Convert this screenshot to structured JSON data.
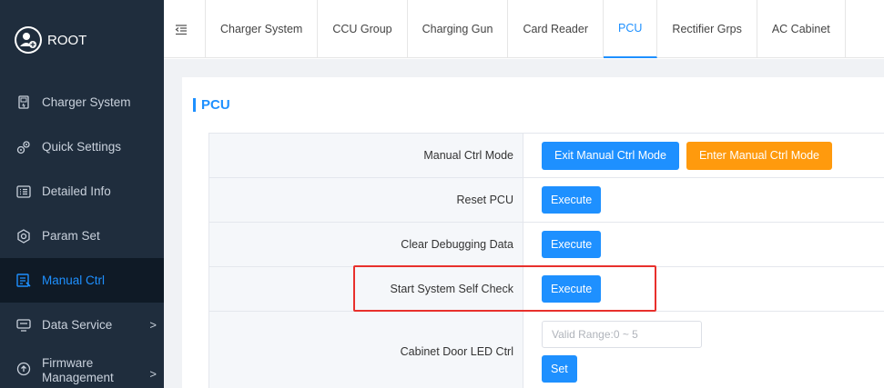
{
  "brand": {
    "title": "ROOT",
    "logo_icon": "user-avatar-icon"
  },
  "sidebar": {
    "items": [
      {
        "label": "Charger System",
        "icon": "charger-icon"
      },
      {
        "label": "Quick Settings",
        "icon": "gears-icon"
      },
      {
        "label": "Detailed Info",
        "icon": "list-icon"
      },
      {
        "label": "Param Set",
        "icon": "settings-icon"
      },
      {
        "label": "Manual Ctrl",
        "icon": "manual-icon",
        "active": true
      },
      {
        "label": "Data Service",
        "icon": "data-icon",
        "has_chevron": true
      },
      {
        "label": "Firmware Management",
        "line1": "Firmware",
        "line2": "Management",
        "icon": "upload-icon",
        "has_chevron": true
      }
    ],
    "chevron": ">"
  },
  "tabs": [
    {
      "label": "Charger System"
    },
    {
      "label": "CCU Group"
    },
    {
      "label": "Charging Gun"
    },
    {
      "label": "Card Reader"
    },
    {
      "label": "PCU",
      "active": true
    },
    {
      "label": "Rectifier Grps"
    },
    {
      "label": "AC Cabinet"
    }
  ],
  "panel": {
    "title": "PCU",
    "rows": [
      {
        "label": "Manual Ctrl Mode",
        "buttons": [
          "Exit Manual Ctrl Mode",
          "Enter Manual Ctrl Mode"
        ]
      },
      {
        "label": "Reset PCU",
        "button": "Execute"
      },
      {
        "label": "Clear Debugging Data",
        "button": "Execute"
      },
      {
        "label": "Start System Self Check",
        "button": "Execute"
      },
      {
        "label": "Cabinet Door LED Ctrl",
        "input_placeholder": "Valid Range:0 ~ 5",
        "button": "Set"
      }
    ]
  },
  "colors": {
    "accent": "#1e90ff",
    "warning": "#ff9a0d",
    "sidebar_bg": "#1f2d3d",
    "highlight": "#e8302c"
  }
}
